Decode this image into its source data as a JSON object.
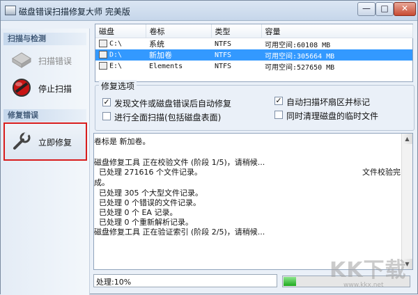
{
  "window": {
    "title": "磁盘错误扫描修复大师 完美版",
    "buttons": {
      "minimize": "—",
      "maximize": "□",
      "close": "✕"
    }
  },
  "sidebar": {
    "scan_section": "扫描与检测",
    "scan_errors_label": "扫描错误",
    "stop_scan_label": "停止扫描",
    "repair_section": "修复错误",
    "repair_now_label": "立即修复"
  },
  "drives": {
    "columns": [
      "磁盘",
      "卷标",
      "类型",
      "容量"
    ],
    "rows": [
      {
        "disk": "C:\\",
        "label": "系统",
        "type": "NTFS",
        "capacity": "可用空间:60108 MB",
        "selected": false
      },
      {
        "disk": "D:\\",
        "label": "新加卷",
        "type": "NTFS",
        "capacity": "可用空间:305664 MB",
        "selected": true
      },
      {
        "disk": "E:\\",
        "label": "Elements",
        "type": "NTFS",
        "capacity": "可用空间:527650 MB",
        "selected": false
      }
    ]
  },
  "options": {
    "title": "修复选项",
    "auto_fix": {
      "label": "发现文件或磁盘错误后自动修复",
      "checked": true
    },
    "full_scan": {
      "label": "进行全面扫描(包括磁盘表面)",
      "checked": false
    },
    "mark_bad": {
      "label": "自动扫描坏扇区并标记",
      "checked": true
    },
    "clean_temp": {
      "label": "同时清理磁盘的临时文件",
      "checked": false
    }
  },
  "log": {
    "lines": [
      "卷标是 新加卷。",
      "",
      "磁盘修复工具 正在校验文件 (阶段 1/5)，请稍候...",
      "  已处理 271616 个文件记录。",
      "成。",
      "  已处理 305 个大型文件记录。",
      "  已处理 0 个错误的文件记录。",
      "  已处理 0 个 EA 记录。",
      "  已处理 0 个重新解析记录。",
      "磁盘修复工具 正在验证索引 (阶段 2/5)，请稍候..."
    ],
    "wrapped_tail": "文件校验完"
  },
  "status": {
    "text": "处理:10%",
    "progress": 0.1
  },
  "watermark": {
    "logo": "KK下载",
    "url": "www.kkx.net"
  },
  "colors": {
    "selection": "#3399ff",
    "highlight_frame": "#d81c1c",
    "progress": "#1eaa1e"
  }
}
